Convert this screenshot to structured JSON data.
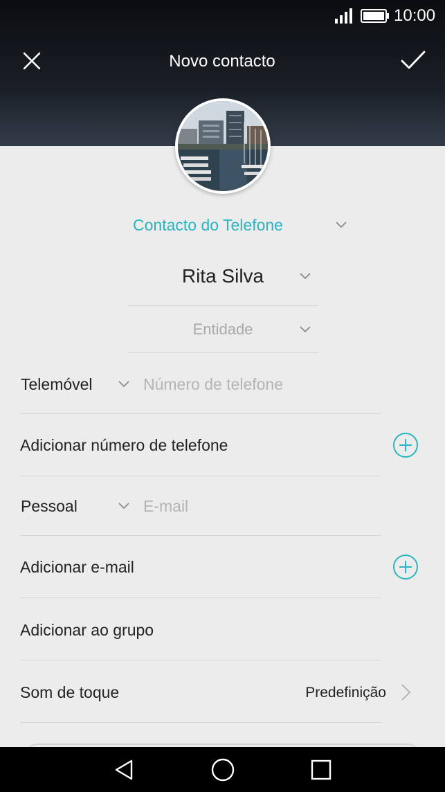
{
  "status_bar": {
    "time": "10:00",
    "signal_icon": "signal-icon",
    "battery_icon": "battery-icon"
  },
  "top_bar": {
    "title": "Novo contacto",
    "close_icon": "close-icon",
    "save_icon": "check-icon"
  },
  "avatar": {
    "icon": "contact-photo"
  },
  "account": {
    "label": "Contacto do Telefone",
    "icon": "chevron-down-icon"
  },
  "name": {
    "value": "Rita Silva"
  },
  "company": {
    "placeholder": "Entidade"
  },
  "phone": {
    "type": "Telemóvel",
    "placeholder": "Número de telefone"
  },
  "add_phone": {
    "label": "Adicionar número de telefone",
    "icon": "add-circle-icon"
  },
  "email": {
    "type": "Pessoal",
    "placeholder": "E-mail"
  },
  "add_email": {
    "label": "Adicionar e-mail",
    "icon": "add-circle-icon"
  },
  "group": {
    "label": "Adicionar ao grupo"
  },
  "ringtone": {
    "label": "Som de toque",
    "value": "Predefinição",
    "icon": "chevron-right-icon"
  },
  "nav_bar": {
    "back_icon": "back-icon",
    "home_icon": "home-icon",
    "recents_icon": "recents-icon"
  },
  "colors": {
    "accent": "#2bb5c0",
    "background": "#ececec",
    "header": "#12161c"
  }
}
